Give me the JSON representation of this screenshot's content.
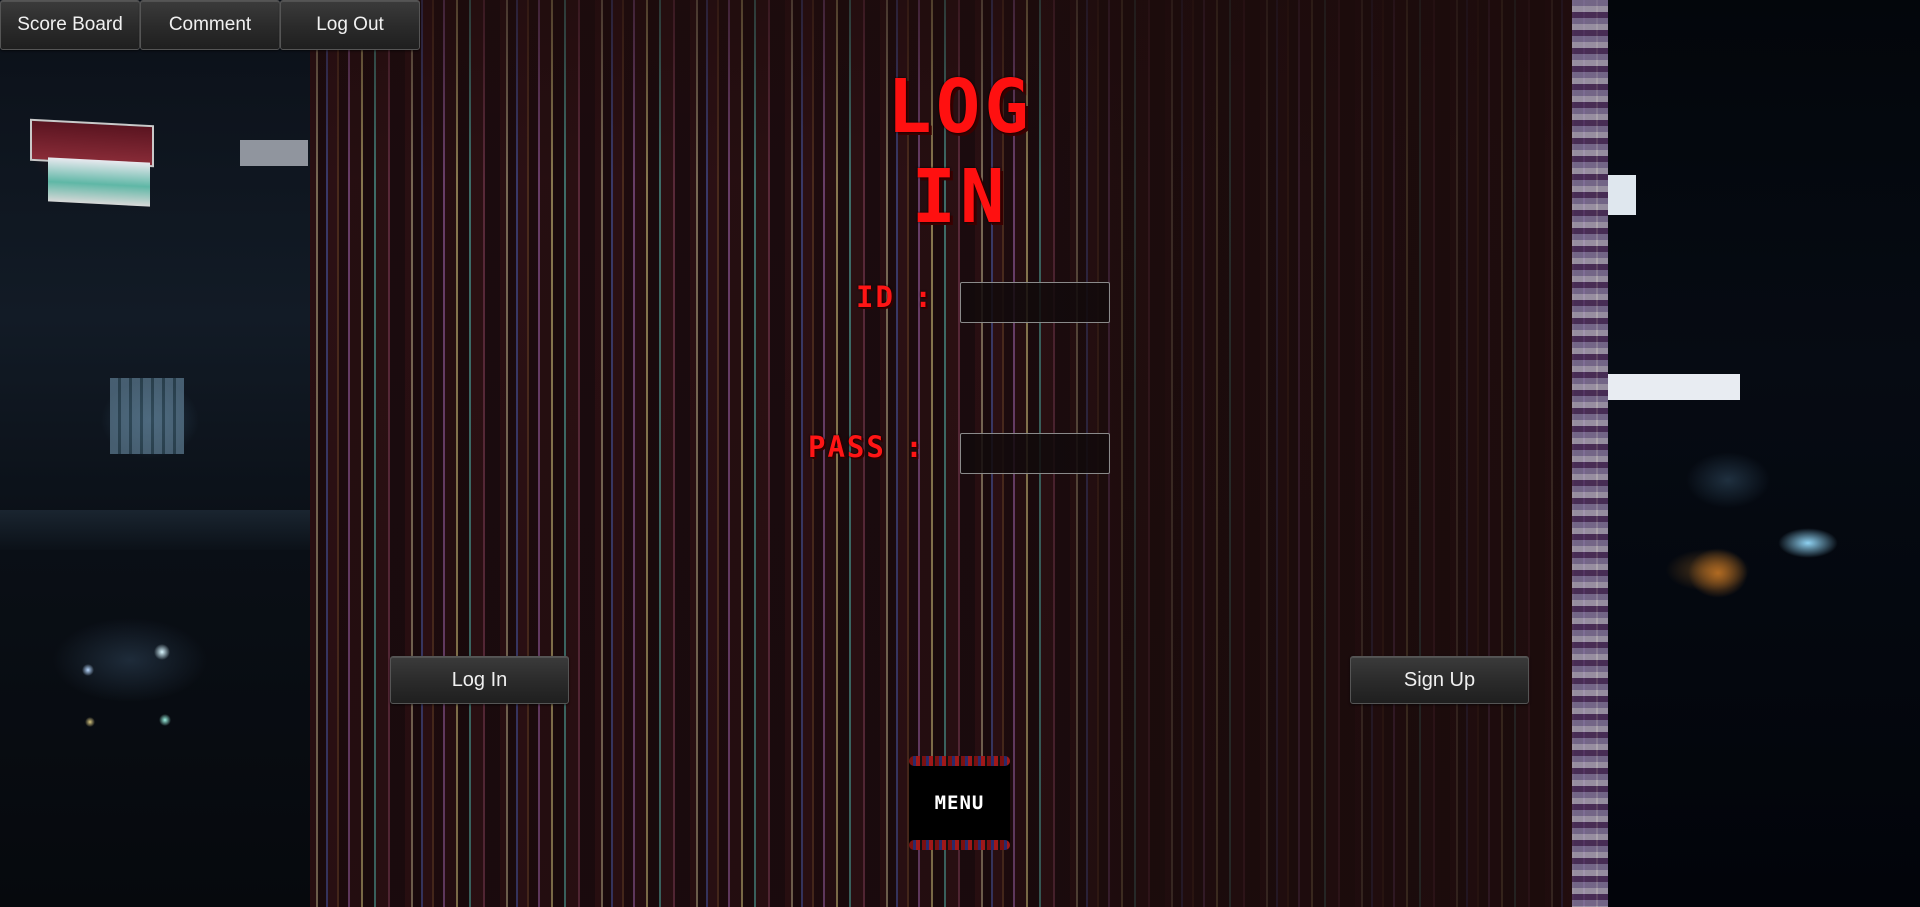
{
  "nav": {
    "score_board": "Score Board",
    "comment": "Comment",
    "log_out": "Log Out"
  },
  "login_form": {
    "title": "LOG IN",
    "id_label": "ID :",
    "pass_label": "PASS :",
    "id_value": "",
    "pass_value": ""
  },
  "actions": {
    "log_in": "Log In",
    "sign_up": "Sign Up"
  },
  "menu": {
    "label": "MENU"
  },
  "colors": {
    "title_red": "#ff1010",
    "button_bg": "#2a2a2a",
    "button_text": "#f0f0f0"
  }
}
